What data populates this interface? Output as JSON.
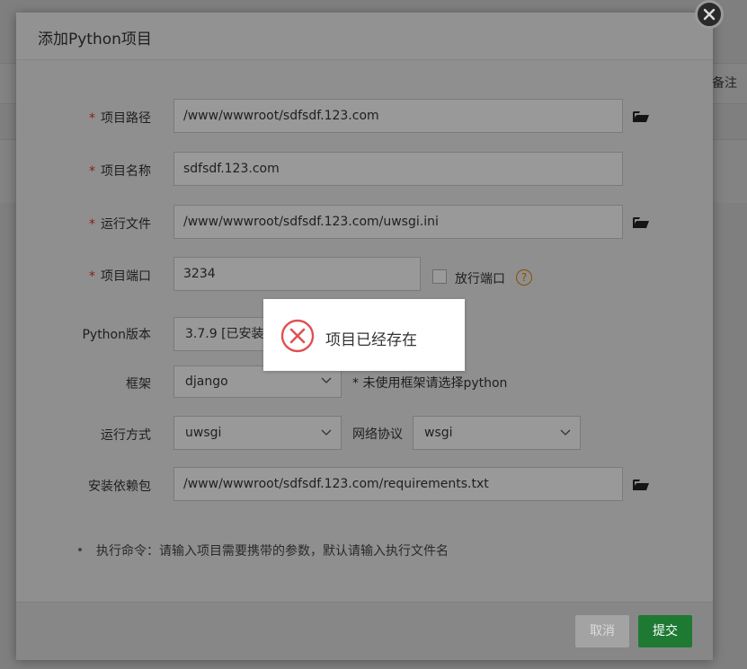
{
  "background": {
    "note_label": "备注"
  },
  "dialog": {
    "title": "添加Python项目",
    "fields": {
      "path": {
        "label": "项目路径",
        "value": "/www/wwwroot/sdfsdf.123.com"
      },
      "name": {
        "label": "项目名称",
        "value": "sdfsdf.123.com"
      },
      "run_file": {
        "label": "运行文件",
        "value": "/www/wwwroot/sdfsdf.123.com/uwsgi.ini"
      },
      "port": {
        "label": "项目端口",
        "value": "3234",
        "release_label": "放行端口",
        "help_icon": "?"
      },
      "python": {
        "label": "Python版本",
        "value": "3.7.9 [已安装"
      },
      "framework": {
        "label": "框架",
        "value": "django",
        "hint": "* 未使用框架请选择python"
      },
      "run_mode": {
        "label": "运行方式",
        "value": "uwsgi",
        "protocol_label": "网络协议",
        "protocol_value": "wsgi"
      },
      "deps": {
        "label": "安装依赖包",
        "value": "/www/wwwroot/sdfsdf.123.com/requirements.txt"
      }
    },
    "note": "执行命令：请输入项目需要携带的参数，默认请输入执行文件名",
    "buttons": {
      "cancel": "取消",
      "submit": "提交"
    }
  },
  "toast": {
    "message": "项目已经存在",
    "icon": "error-circle-icon"
  },
  "colors": {
    "submit": "#1e7a33",
    "error": "#e05050",
    "required": "#8b1a1a"
  }
}
